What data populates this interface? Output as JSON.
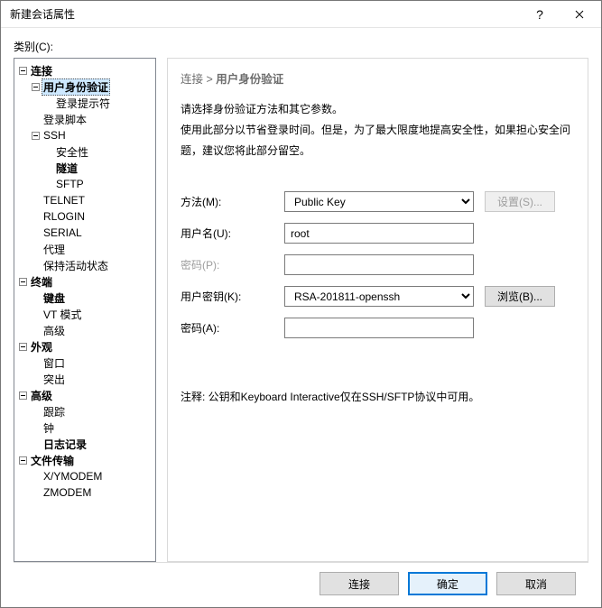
{
  "window": {
    "title": "新建会话属性"
  },
  "category_label": "类别(C):",
  "tree": {
    "connection": "连接",
    "user_auth": "用户身份验证",
    "login_prompt": "登录提示符",
    "login_script": "登录脚本",
    "ssh": "SSH",
    "security": "安全性",
    "tunnel": "隧道",
    "sftp": "SFTP",
    "telnet": "TELNET",
    "rlogin": "RLOGIN",
    "serial": "SERIAL",
    "proxy": "代理",
    "keepalive": "保持活动状态",
    "terminal": "终端",
    "keyboard": "键盘",
    "vt_mode": "VT 模式",
    "advanced_term": "高级",
    "appearance": "外观",
    "window": "窗口",
    "highlight": "突出",
    "advanced": "高级",
    "trace": "跟踪",
    "bell": "钟",
    "logging": "日志记录",
    "file_transfer": "文件传输",
    "xymodem": "X/YMODEM",
    "zmodem": "ZMODEM"
  },
  "breadcrumb": {
    "root": "连接",
    "sep": ">",
    "current": "用户身份验证"
  },
  "description": {
    "line1": "请选择身份验证方法和其它参数。",
    "line2": "使用此部分以节省登录时间。但是，为了最大限度地提高安全性，如果担心安全问题，建议您将此部分留空。"
  },
  "form": {
    "method_label": "方法(M):",
    "method_value": "Public Key",
    "settings_btn": "设置(S)...",
    "username_label": "用户名(U):",
    "username_value": "root",
    "password_label": "密码(P):",
    "userkey_label": "用户密钥(K):",
    "userkey_value": "RSA-201811-openssh",
    "browse_btn": "浏览(B)...",
    "passphrase_label": "密码(A):"
  },
  "note": "注释: 公钥和Keyboard Interactive仅在SSH/SFTP协议中可用。",
  "footer": {
    "connect": "连接",
    "ok": "确定",
    "cancel": "取消"
  }
}
